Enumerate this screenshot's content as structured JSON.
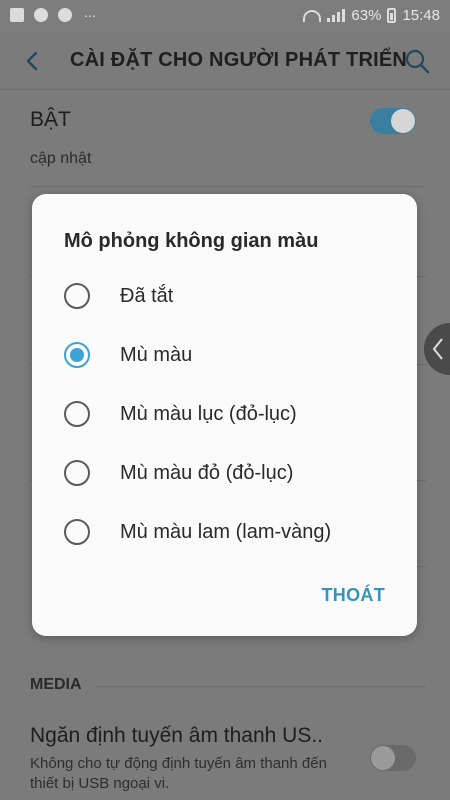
{
  "status_bar": {
    "battery_percent": "63%",
    "time": "15:48",
    "notification_more": "..."
  },
  "app_bar": {
    "title": "CÀI ĐẶT CHO NGƯỜI PHÁT TRIỂN"
  },
  "background": {
    "master_toggle_label": "BẬT",
    "master_toggle_on": true,
    "partial_subtext": "cập nhật",
    "section_media": "MEDIA",
    "usb_audio": {
      "title": "Ngăn định tuyến âm thanh US..",
      "subtitle": "Không cho tự động định tuyến âm thanh đến thiết bị USB ngoại vi.",
      "toggle_on": false
    }
  },
  "dialog": {
    "title": "Mô phỏng không gian màu",
    "options": [
      {
        "label": "Đã tắt",
        "selected": false
      },
      {
        "label": "Mù màu",
        "selected": true
      },
      {
        "label": "Mù màu lục (đỏ-lục)",
        "selected": false
      },
      {
        "label": "Mù màu đỏ (đỏ-lục)",
        "selected": false
      },
      {
        "label": "Mù màu lam (lam-vàng)",
        "selected": false
      }
    ],
    "exit_label": "THOÁT"
  },
  "colors": {
    "accent": "#3da3d4",
    "dim_overlay": "#7b7b7b",
    "toggle_on_track": "#3a7fa0"
  }
}
